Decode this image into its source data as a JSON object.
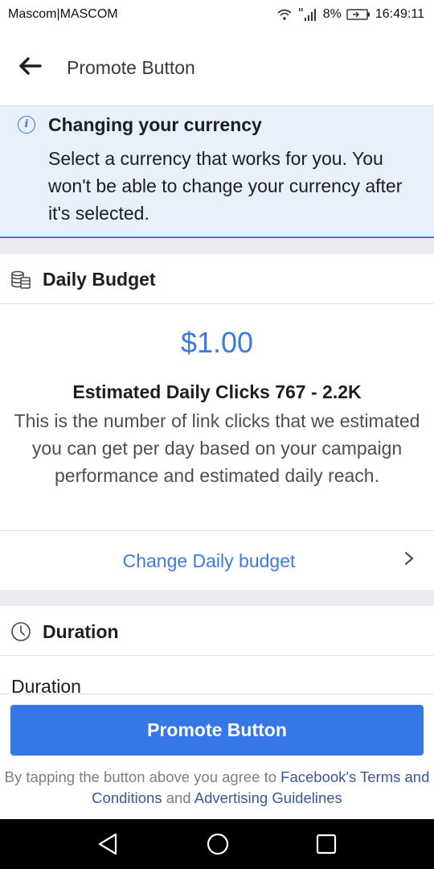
{
  "status_bar": {
    "carrier": "Mascom|MASCOM",
    "battery": "8%",
    "time": "16:49:11"
  },
  "header": {
    "title": "Promote Button"
  },
  "notice": {
    "title": "Changing your currency",
    "text": "Select a currency that works for you. You won't be able to change your currency after it's selected."
  },
  "budget": {
    "section_title": "Daily Budget",
    "amount": "$1.00",
    "estimate_title": "Estimated Daily Clicks 767 - 2.2K",
    "estimate_text": "This is the number of link clicks that we estimated you can get per day based on your campaign performance and estimated daily reach.",
    "change_label": "Change Daily budget"
  },
  "duration": {
    "section_title": "Duration",
    "field_label": "Duration"
  },
  "footer": {
    "button_label": "Promote Button",
    "terms_prefix": "By tapping the button above you agree to ",
    "terms_link": "Facebook's Terms and Conditions",
    "terms_and": " and ",
    "guidelines_link": "Advertising Guidelines"
  },
  "colors": {
    "accent": "#3578e5",
    "link": "#385898",
    "banner_bg": "#e7f0fb"
  }
}
